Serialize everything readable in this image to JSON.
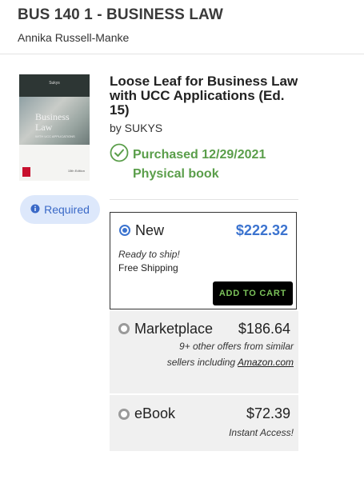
{
  "course": {
    "title": "BUS 140 1 - BUSINESS LAW",
    "instructor": "Annika Russell-Manke"
  },
  "book": {
    "title": "Loose Leaf for Business Law with UCC Applications (Ed. 15)",
    "author": "by SUKYS",
    "purchased": "Purchased 12/29/2021",
    "format": "Physical book",
    "status_color": "#5a9e4a",
    "cover": {
      "author_text": "Sukys",
      "title_line1": "Business",
      "title_line2": "Law",
      "subtitle": "WITH UCC APPLICATIONS",
      "edition": "15th Edition"
    }
  },
  "badge": {
    "label": "Required",
    "icon": "info-icon"
  },
  "options": {
    "new": {
      "label": "New",
      "price": "$222.32",
      "note1": "Ready to ship!",
      "note2": "Free Shipping",
      "button": "ADD TO CART",
      "selected": true
    },
    "marketplace": {
      "label": "Marketplace",
      "price": "$186.64",
      "note_prefix": "9+ other offers from similar sellers including ",
      "note_link": "Amazon.com"
    },
    "ebook": {
      "label": "eBook",
      "price": "$72.39",
      "note": "Instant Access!"
    }
  },
  "colors": {
    "accent": "#3b73cf",
    "badge_bg": "#dde8fb",
    "button_bg": "#000000",
    "button_text": "#7bc25a"
  }
}
